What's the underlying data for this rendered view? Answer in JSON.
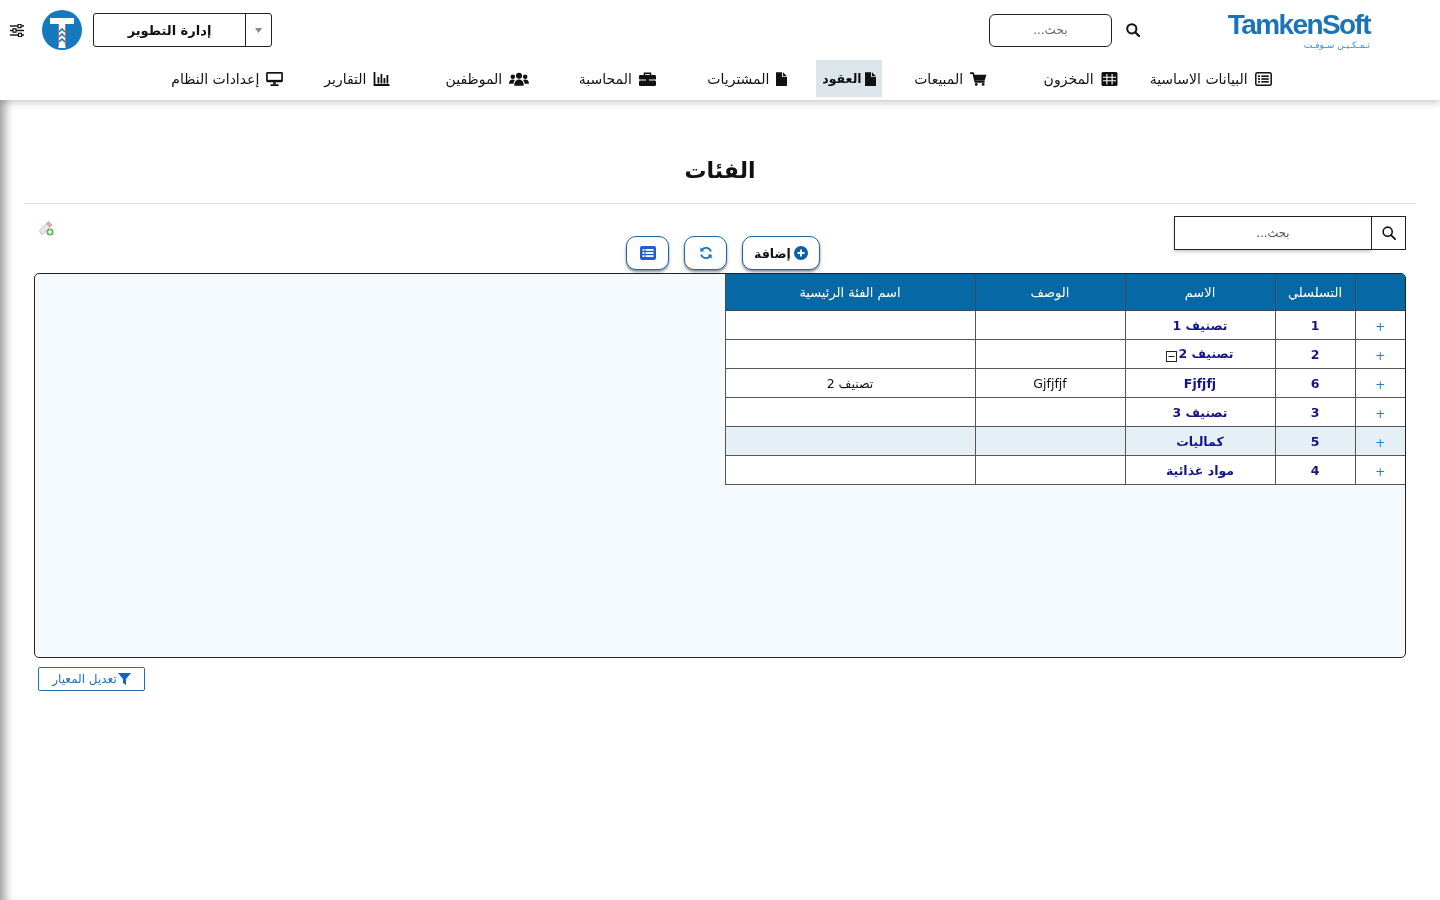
{
  "header": {
    "logo": {
      "name": "TamkenSoft",
      "tagline": "تـمـكـيـن سـوفـت"
    },
    "search": {
      "placeholder": "بحث..."
    },
    "department": {
      "value": "إدارة التطوير"
    }
  },
  "nav": [
    {
      "label": "البيانات الاساسية",
      "selected": false
    },
    {
      "label": "المخزون",
      "selected": false
    },
    {
      "label": "المبيعات",
      "selected": false
    },
    {
      "label": "العقود",
      "selected": true
    },
    {
      "label": "المشتريات",
      "selected": false
    },
    {
      "label": "المحاسبة",
      "selected": false
    },
    {
      "label": "الموظفين",
      "selected": false
    },
    {
      "label": "التقارير",
      "selected": false
    },
    {
      "label": "إعدادات النظام",
      "selected": false
    }
  ],
  "page": {
    "title": "الفئات"
  },
  "toolbar": {
    "search": {
      "placeholder": "بحث..."
    },
    "buttons": [
      {
        "kind": "add",
        "label": "إضافة"
      },
      {
        "kind": "refresh"
      },
      {
        "kind": "list"
      }
    ]
  },
  "table": {
    "columns": [
      "التسلسلي",
      "الاسم",
      "الوصف",
      "اسم الفئة الرئيسية"
    ],
    "rows": [
      {
        "toggle": "+",
        "serial": "1",
        "name": "تصنيف 1",
        "expanded": false,
        "selected": false
      },
      {
        "toggle": "+",
        "serial": "2",
        "name": "تصنيف 2",
        "expanded": true,
        "selected": false
      },
      {
        "toggle": "+",
        "serial": "6",
        "name": "Fjfjfj",
        "description": "Gjfjfjf",
        "parent": "تصنيف 2",
        "expanded": false,
        "selected": false
      },
      {
        "toggle": "+",
        "serial": "3",
        "name": "تصنيف 3",
        "expanded": false,
        "selected": false
      },
      {
        "toggle": "+",
        "serial": "5",
        "name": "كماليات",
        "expanded": false,
        "selected": true
      },
      {
        "toggle": "+",
        "serial": "4",
        "name": "مواد غذائية",
        "expanded": false,
        "selected": false
      }
    ]
  },
  "filter_button": {
    "label": "تعديل المعيار"
  }
}
